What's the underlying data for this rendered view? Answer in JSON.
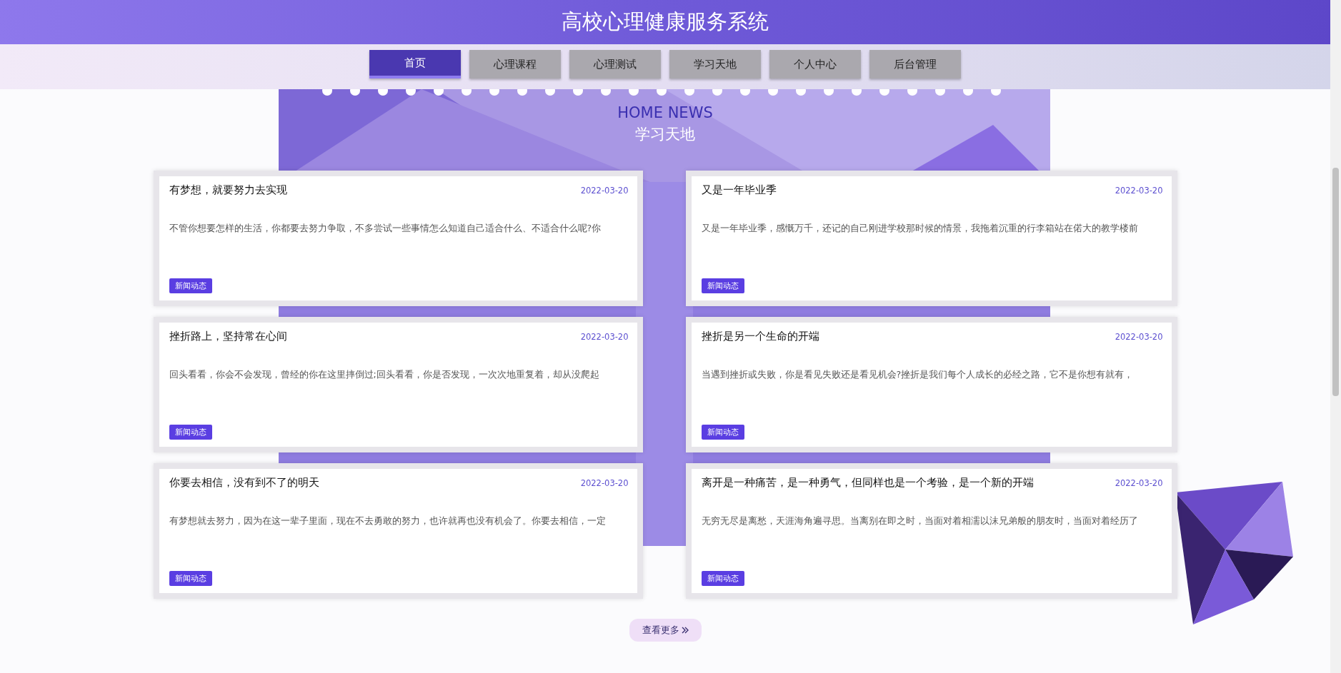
{
  "header": {
    "title": "高校心理健康服务系统"
  },
  "nav": [
    {
      "label": "首页",
      "selected": true
    },
    {
      "label": "心理课程",
      "selected": false
    },
    {
      "label": "心理测试",
      "selected": false
    },
    {
      "label": "学习天地",
      "selected": false
    },
    {
      "label": "个人中心",
      "selected": false
    },
    {
      "label": "后台管理",
      "selected": false
    }
  ],
  "section": {
    "title_en": "HOME NEWS",
    "title_cn": "学习天地"
  },
  "news": [
    {
      "title": "有梦想，就要努力去实现",
      "date": "2022-03-20",
      "excerpt": "不管你想要怎样的生活，你都要去努力争取，不多尝试一些事情怎么知道自己适合什么、不适合什么呢?你",
      "tag": "新闻动态"
    },
    {
      "title": "又是一年毕业季",
      "date": "2022-03-20",
      "excerpt": "又是一年毕业季，感慨万千，还记的自己刚进学校那时候的情景，我拖着沉重的行李箱站在偌大的教学楼前",
      "tag": "新闻动态"
    },
    {
      "title": "挫折路上，坚持常在心间",
      "date": "2022-03-20",
      "excerpt": "回头看看，你会不会发现，曾经的你在这里摔倒过;回头看看，你是否发现，一次次地重复着，却从没爬起",
      "tag": "新闻动态"
    },
    {
      "title": "挫折是另一个生命的开端",
      "date": "2022-03-20",
      "excerpt": "当遇到挫折或失败，你是看见失败还是看见机会?挫折是我们每个人成长的必经之路，它不是你想有就有，",
      "tag": "新闻动态"
    },
    {
      "title": "你要去相信，没有到不了的明天",
      "date": "2022-03-20",
      "excerpt": "有梦想就去努力，因为在这一辈子里面，现在不去勇敢的努力，也许就再也没有机会了。你要去相信，一定",
      "tag": "新闻动态"
    },
    {
      "title": "离开是一种痛苦，是一种勇气，但同样也是一个考验，是一个新的开端",
      "date": "2022-03-20",
      "excerpt": "无穷无尽是离愁，天涯海角遍寻思。当离别在即之时，当面对着相濡以沫兄弟般的朋友时，当面对着经历了",
      "tag": "新闻动态"
    }
  ],
  "more_button": {
    "label": "查看更多"
  }
}
